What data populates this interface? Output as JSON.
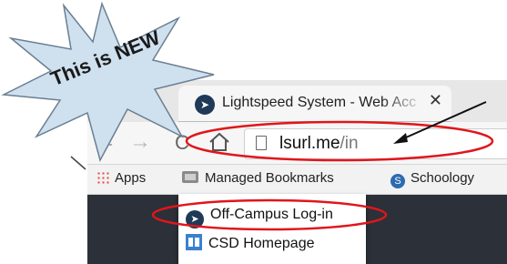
{
  "starburst": {
    "label": "This is NEW",
    "fill": "#cfe0ef"
  },
  "tab": {
    "title": "Lightspeed System - Web Acc",
    "close": "✕",
    "icon": "navigation-arrow-icon"
  },
  "toolbar": {
    "back": "←",
    "forward": "→",
    "reload": "C",
    "home": "home-icon"
  },
  "omnibox": {
    "host": "lsurl.me",
    "path": "/in"
  },
  "bookmarks": [
    {
      "label": "Apps",
      "icon": "apps-grid-icon"
    },
    {
      "label": "Managed Bookmarks",
      "icon": "folder-icon"
    },
    {
      "label": "Schoology",
      "icon": "schoology-icon"
    }
  ],
  "dropdown": [
    {
      "label": "Off-Campus Log-in",
      "icon": "navigation-arrow-icon"
    },
    {
      "label": "CSD Homepage",
      "icon": "calendar-page-icon"
    }
  ],
  "colors": {
    "highlight": "#e0161b",
    "page_background": "#2c3038"
  }
}
